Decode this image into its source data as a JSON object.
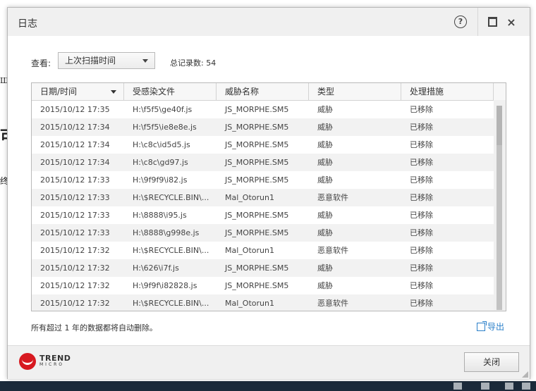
{
  "background": {
    "frag1": "Ш",
    "frag2": "可",
    "frag3": "终"
  },
  "window": {
    "title": "日志",
    "help_glyph": "?",
    "close_glyph": "×"
  },
  "toolbar": {
    "view_label": "查看:",
    "view_selected": "上次扫描时间",
    "total_label": "总记录数: 54"
  },
  "table": {
    "columns": [
      "日期/时间",
      "受感染文件",
      "威胁名称",
      "类型",
      "处理措施"
    ],
    "rows": [
      [
        "2015/10/12 17:35",
        "H:\\f5f5\\ge40f.js",
        "JS_MORPHE.SM5",
        "威胁",
        "已移除"
      ],
      [
        "2015/10/12 17:34",
        "H:\\f5f5\\ie8e8e.js",
        "JS_MORPHE.SM5",
        "威胁",
        "已移除"
      ],
      [
        "2015/10/12 17:34",
        "H:\\c8c\\id5d5.js",
        "JS_MORPHE.SM5",
        "威胁",
        "已移除"
      ],
      [
        "2015/10/12 17:34",
        "H:\\c8c\\gd97.js",
        "JS_MORPHE.SM5",
        "威胁",
        "已移除"
      ],
      [
        "2015/10/12 17:33",
        "H:\\9f9f9\\i82.js",
        "JS_MORPHE.SM5",
        "威胁",
        "已移除"
      ],
      [
        "2015/10/12 17:33",
        "H:\\$RECYCLE.BIN\\...",
        "Mal_Otorun1",
        "恶意软件",
        "已移除"
      ],
      [
        "2015/10/12 17:33",
        "H:\\8888\\i95.js",
        "JS_MORPHE.SM5",
        "威胁",
        "已移除"
      ],
      [
        "2015/10/12 17:33",
        "H:\\8888\\g998e.js",
        "JS_MORPHE.SM5",
        "威胁",
        "已移除"
      ],
      [
        "2015/10/12 17:32",
        "H:\\$RECYCLE.BIN\\...",
        "Mal_Otorun1",
        "恶意软件",
        "已移除"
      ],
      [
        "2015/10/12 17:32",
        "H:\\626\\i7f.js",
        "JS_MORPHE.SM5",
        "威胁",
        "已移除"
      ],
      [
        "2015/10/12 17:32",
        "H:\\9f9f\\i82828.js",
        "JS_MORPHE.SM5",
        "威胁",
        "已移除"
      ],
      [
        "2015/10/12 17:32",
        "H:\\$RECYCLE.BIN\\...",
        "Mal_Otorun1",
        "恶意软件",
        "已移除"
      ]
    ]
  },
  "footer": {
    "note": "所有超过 1 年的数据都将自动删除。",
    "export_label": "导出",
    "logo_line1": "TREND",
    "logo_line2": "MICRO",
    "close_label": "关闭"
  }
}
